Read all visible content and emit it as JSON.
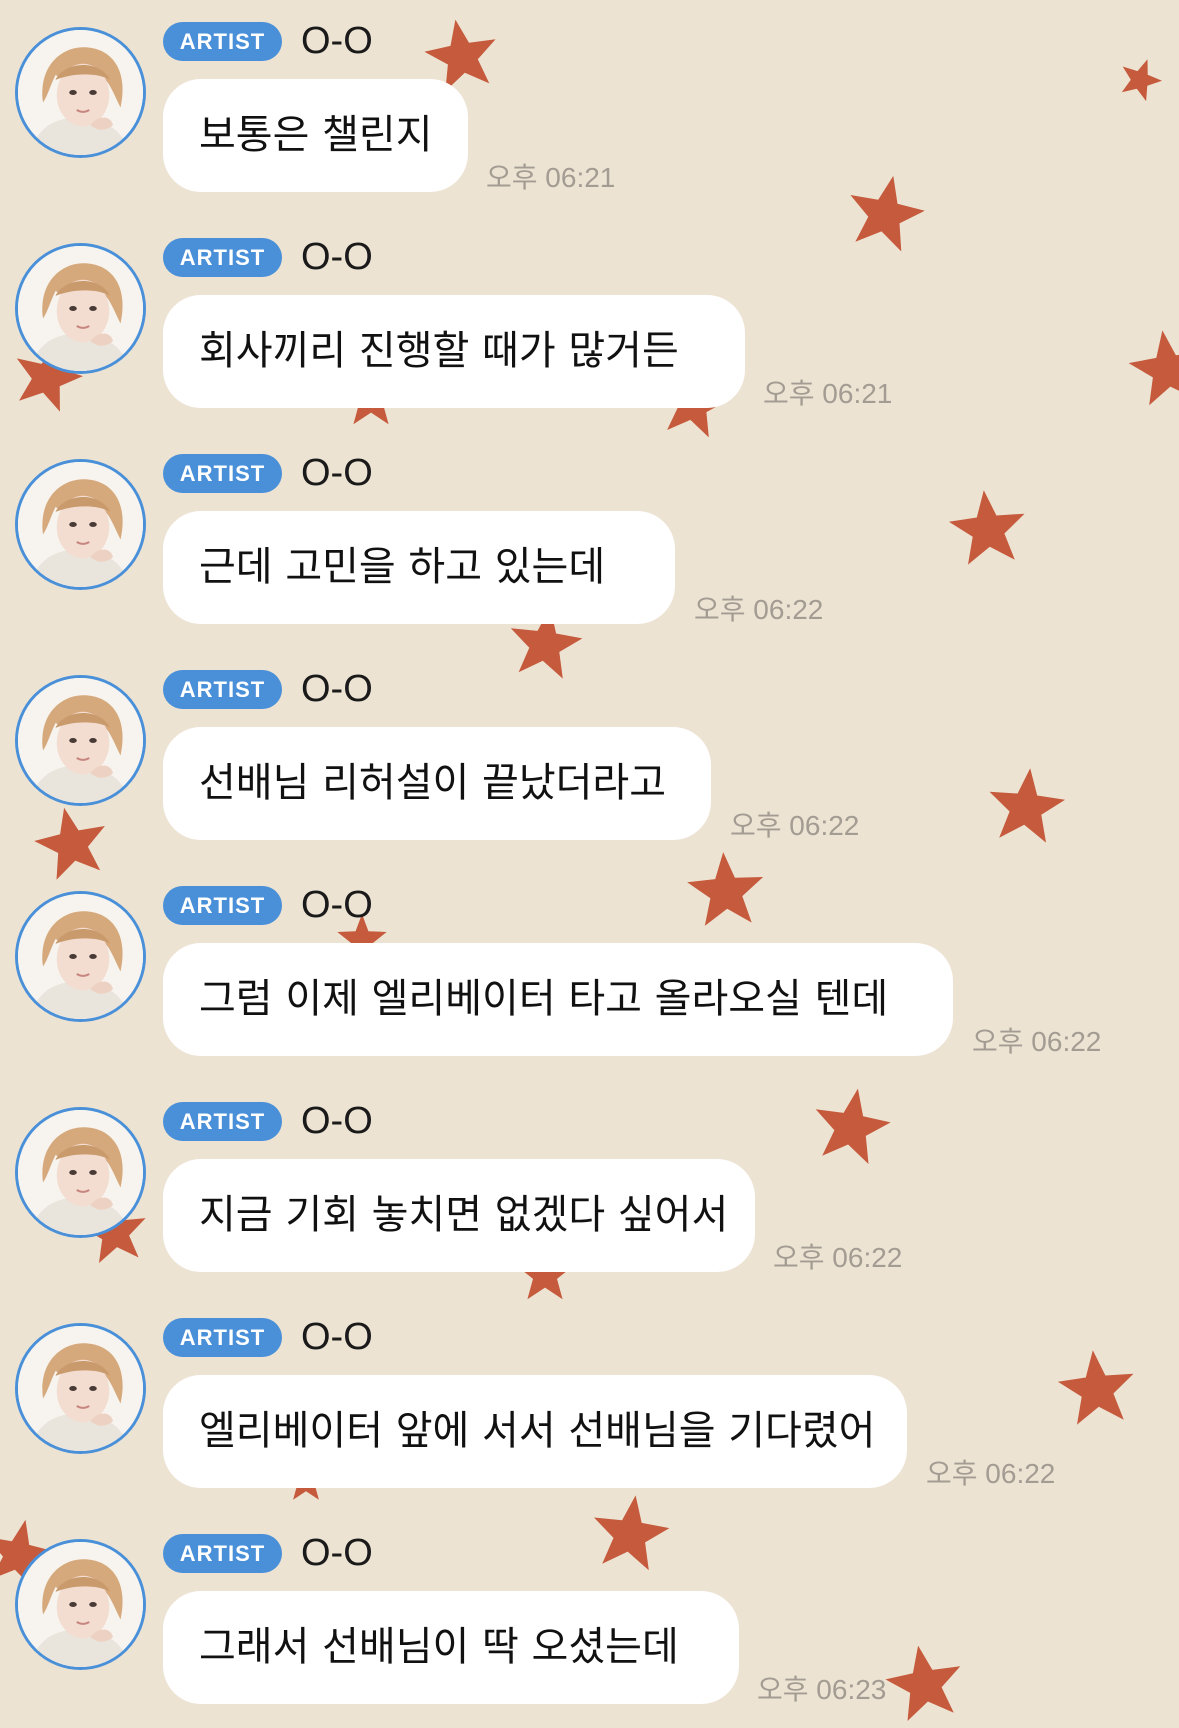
{
  "theme": {
    "background": "#ede3d3",
    "star_color": "#c55a3c",
    "accent": "#4a90d9",
    "bubble": "#ffffff",
    "time_color": "#a39c92"
  },
  "messages": [
    {
      "badge": "ARTIST",
      "sender": "O-O",
      "text": "보통은 챌린지",
      "time": "오후 06:21",
      "avatar": "profile-photo"
    },
    {
      "badge": "ARTIST",
      "sender": "O-O",
      "text": "회사끼리 진행할 때가 많거든",
      "time": "오후 06:21",
      "avatar": "profile-photo"
    },
    {
      "badge": "ARTIST",
      "sender": "O-O",
      "text": "근데 고민을 하고 있는데",
      "time": "오후 06:22",
      "avatar": "profile-photo"
    },
    {
      "badge": "ARTIST",
      "sender": "O-O",
      "text": "선배님 리허설이 끝났더라고",
      "time": "오후 06:22",
      "avatar": "profile-photo"
    },
    {
      "badge": "ARTIST",
      "sender": "O-O",
      "text": "그럼 이제 엘리베이터 타고 올라오실 텐데",
      "time": "오후 06:22",
      "avatar": "profile-photo"
    },
    {
      "badge": "ARTIST",
      "sender": "O-O",
      "text": "지금 기회 놓치면 없겠다 싶어서",
      "time": "오후 06:22",
      "avatar": "profile-photo"
    },
    {
      "badge": "ARTIST",
      "sender": "O-O",
      "text": "엘리베이터 앞에 서서 선배님을 기다렸어",
      "time": "오후 06:22",
      "avatar": "profile-photo"
    },
    {
      "badge": "ARTIST",
      "sender": "O-O",
      "text": "그래서 선배님이 딱 오셨는데",
      "time": "오후 06:23",
      "avatar": "profile-photo"
    }
  ]
}
